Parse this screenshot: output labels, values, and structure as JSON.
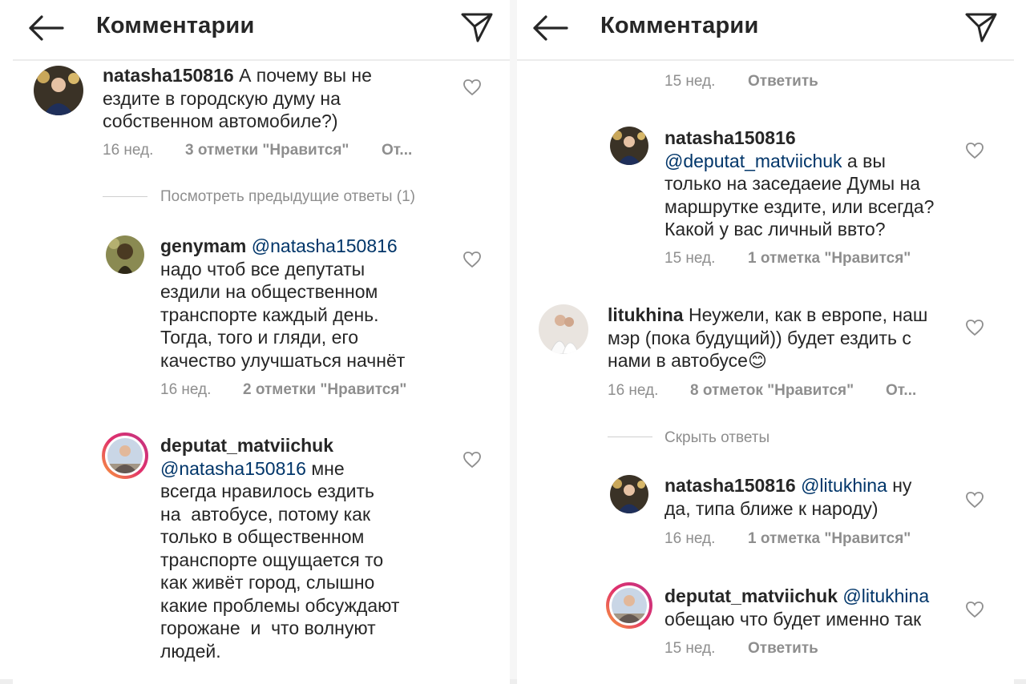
{
  "header": {
    "title": "Комментарии"
  },
  "left": {
    "comments": [
      {
        "user": "natasha150816",
        "mention": "",
        "text": "А почему вы не",
        "text2": "ездите в городскую думу на",
        "text3": "собственном автомобиле?)",
        "time": "16 нед.",
        "likes": "3 отметки \"Нравится\"",
        "reply": "От..."
      },
      {
        "user": "genymam",
        "mention": "@natasha150816",
        "text": "надо чтоб все депутаты",
        "text2": "ездили на общественном",
        "text3": "транспорте каждый день.",
        "text4": "Тогда, того и гляди, его",
        "text5": "качество улучшаться начнёт",
        "time": "16 нед.",
        "likes": "2 отметки \"Нравится\""
      },
      {
        "user": "deputat_matviichuk",
        "mention": "@natasha150816",
        "text": "мне",
        "text2": "всегда нравилось ездить",
        "text3": "на  автобусе, потому как",
        "text4": "только в общественном",
        "text5": "транспорте ощущается то",
        "text6": "как живёт город, слышно",
        "text7": "какие проблемы обсуждают",
        "text8": "горожане  и  что волнуют",
        "text9": "людей."
      }
    ],
    "view_previous": "Посмотреть предыдущие ответы (1)"
  },
  "right": {
    "top_meta": {
      "time": "15 нед.",
      "reply": "Ответить"
    },
    "comments": [
      {
        "user": "natasha150816",
        "mention": "@deputat_matviichuk",
        "text": "а вы",
        "text2": "только на заседаеие Думы на",
        "text3": "маршрутке ездите, или всегда?",
        "text4": "Какой у вас личный ввто?",
        "time": "15 нед.",
        "likes": "1 отметка \"Нравится\""
      },
      {
        "user": "litukhina",
        "text": "Неужели, как в европе, наш",
        "text2": "мэр (пока будущий)) будет ездить с",
        "text3": "нами в автобусе",
        "emoji": "😊",
        "time": "16 нед.",
        "likes": "8 отметок \"Нравится\"",
        "reply": "От..."
      },
      {
        "user": "natasha150816",
        "mention": "@litukhina",
        "text": "ну",
        "text2": "да, типа ближе к народу)",
        "time": "16 нед.",
        "likes": "1 отметка \"Нравится\""
      },
      {
        "user": "deputat_matviichuk",
        "mention": "@litukhina",
        "text": "обещаю что будет именно так",
        "time": "15 нед.",
        "reply": "Ответить"
      }
    ],
    "hide_replies": "Скрыть ответы"
  }
}
